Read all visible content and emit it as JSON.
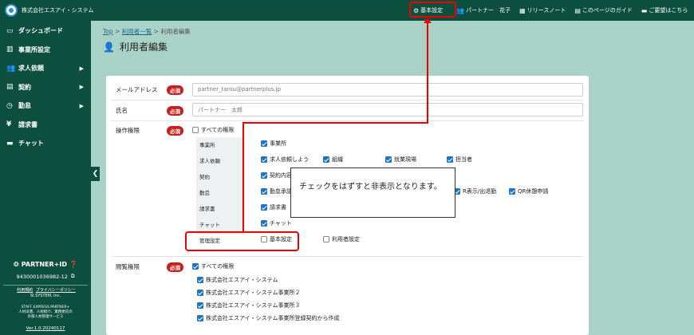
{
  "app": {
    "company": "株式会社エスアイ・システム"
  },
  "topnav": {
    "settings": "基本設定",
    "partner": "パートナー　花子",
    "release": "リリースノート",
    "guide": "このページのガイド",
    "request": "ご要望はこちら"
  },
  "sidebar": {
    "items": [
      {
        "label": "ダッシュボード",
        "icon": "dashboard-icon",
        "has_arrow": false
      },
      {
        "label": "事業所設定",
        "icon": "office-icon",
        "has_arrow": false
      },
      {
        "label": "求人依頼",
        "icon": "people-icon",
        "has_arrow": true
      },
      {
        "label": "契約",
        "icon": "document-icon",
        "has_arrow": true
      },
      {
        "label": "勤怠",
        "icon": "clock-icon",
        "has_arrow": true
      },
      {
        "label": "請求書",
        "icon": "yen-icon",
        "has_arrow": false
      },
      {
        "label": "チャット",
        "icon": "chat-icon",
        "has_arrow": false
      }
    ],
    "partner_id_label": "PARTNER+ID",
    "partner_id": "9430001036982-12",
    "links": [
      "利用規約",
      "プライバシーポリシー"
    ],
    "company_en": "SI.SYSTEM, Inc.",
    "service_name": "STAFF EXPRESS PARTNER+",
    "service_desc1": "人材派遣、人材紹介、業務委託の",
    "service_desc2": "外部人材管理サービス",
    "version": "Ver.1.0.20240117"
  },
  "breadcrumb": {
    "top": "Top",
    "list": "利用者一覧",
    "current": "利用者編集",
    "sep": ">"
  },
  "page_title": "利用者編集",
  "form": {
    "required_label": "必須",
    "email": {
      "label": "メールアドレス",
      "value": "partner_tarou@partnerplus.jp"
    },
    "name": {
      "label": "氏名",
      "value": "パートナー　太郎"
    },
    "permissions": {
      "label": "操作権限",
      "all": "すべての権限",
      "all_checked": false,
      "categories": [
        {
          "name": "事業所",
          "options": [
            {
              "label": "事業所",
              "checked": true
            }
          ]
        },
        {
          "name": "求人依頼",
          "options": [
            {
              "label": "求人依頼しよう",
              "checked": true
            },
            {
              "label": "組織",
              "checked": true
            },
            {
              "label": "就業現場",
              "checked": true
            },
            {
              "label": "担当者",
              "checked": true
            }
          ]
        },
        {
          "name": "契約",
          "options": [
            {
              "label": "契約内容",
              "checked": true
            }
          ]
        },
        {
          "name": "勤怠",
          "options": [
            {
              "label": "勤怠承認",
              "checked": true
            },
            {
              "label": "R表示/出退勤",
              "checked": true
            },
            {
              "label": "QR休憩申請",
              "checked": true
            }
          ]
        },
        {
          "name": "請求書",
          "options": [
            {
              "label": "請求書",
              "checked": true
            }
          ]
        },
        {
          "name": "チャット",
          "options": [
            {
              "label": "チャット",
              "checked": true
            }
          ]
        },
        {
          "name": "管理設定",
          "options": [
            {
              "label": "基本設定",
              "checked": false
            },
            {
              "label": "利用者設定",
              "checked": false
            }
          ]
        }
      ]
    },
    "view_permissions": {
      "label": "閲覧権限",
      "all": "すべての権限",
      "all_checked": true,
      "offices": [
        "株式会社エスアイ・システム",
        "株式会社エスアイ・システム事業所２",
        "株式会社エスアイ・システム事業所３",
        "株式会社エスアイ・システム事業所登録契約から作成"
      ]
    }
  },
  "callout": {
    "text": "チェックをはずすと非表示となります。"
  },
  "colors": {
    "header_bg": "#0d4f3e",
    "background": "#a9d3c6",
    "required": "#c81e1e",
    "checkbox": "#1c73c9",
    "annotation": "#e00000"
  }
}
